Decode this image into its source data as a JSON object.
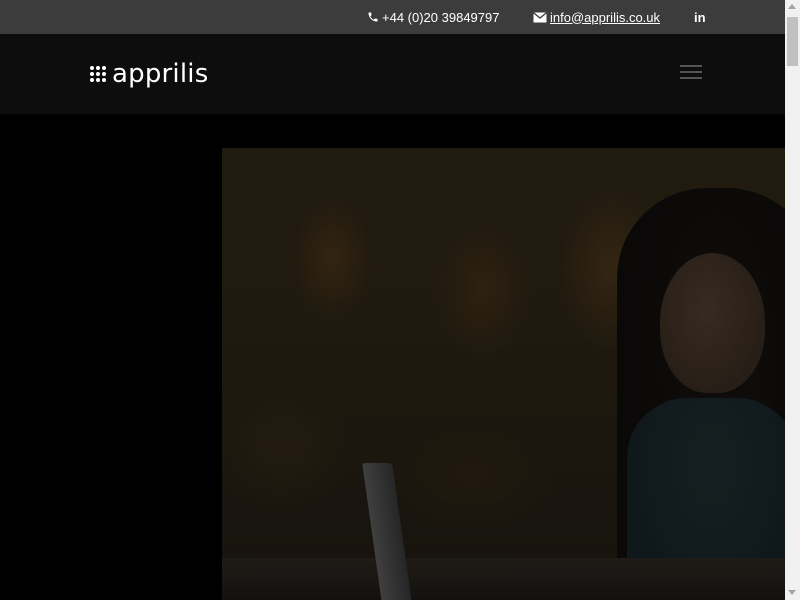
{
  "topbar": {
    "phone": "+44 (0)20 39849797",
    "phone_icon": "phone-icon",
    "email": "info@apprilis.co.uk",
    "email_icon": "envelope-icon",
    "linkedin": "in",
    "linkedin_icon": "linkedin-icon",
    "background": "#3c3c3c"
  },
  "header": {
    "logo_text": "apprilis",
    "logo_icon": "dot-grid-icon",
    "menu_icon": "hamburger-menu-icon",
    "background": "#0d0d0d"
  },
  "hero": {
    "image": "woman-with-laptop-photo",
    "background": "#000000"
  }
}
